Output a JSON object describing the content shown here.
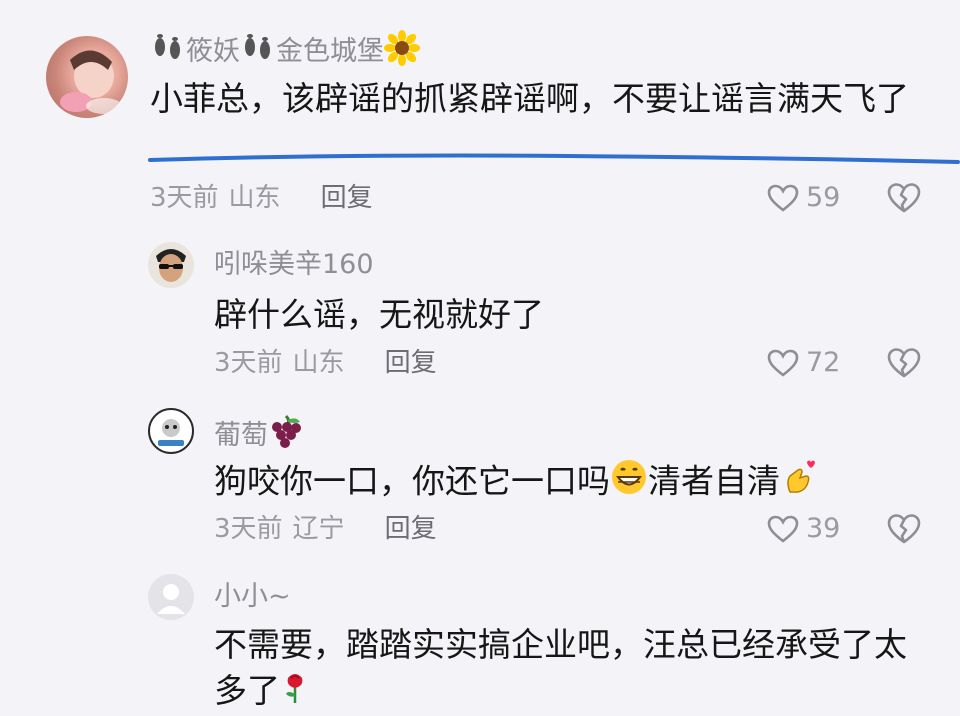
{
  "comments": [
    {
      "username": "筱妖",
      "username_suffix": "金色城堡",
      "text": "小菲总，该辟谣的抓紧辟谣啊，不要让谣言满天飞了",
      "time": "3天前",
      "location": "山东",
      "reply_label": "回复",
      "likes": "59"
    },
    {
      "username": "吲哚美辛160",
      "text": "辟什么谣，无视就好了",
      "time": "3天前",
      "location": "山东",
      "reply_label": "回复",
      "likes": "72"
    },
    {
      "username": "葡萄",
      "text_part1": "狗咬你一口，你还它一口吗",
      "text_part2": "清者自清",
      "time": "3天前",
      "location": "辽宁",
      "reply_label": "回复",
      "likes": "39"
    },
    {
      "username": "小小~",
      "text": "不需要，踏踏实实搞企业吧，汪总已经承受了太多了"
    }
  ],
  "colors": {
    "background": "#f4f3f7",
    "username": "#8e8e94",
    "text": "#161616",
    "meta": "#9a9aa0",
    "underline": "#2f6fd0"
  }
}
